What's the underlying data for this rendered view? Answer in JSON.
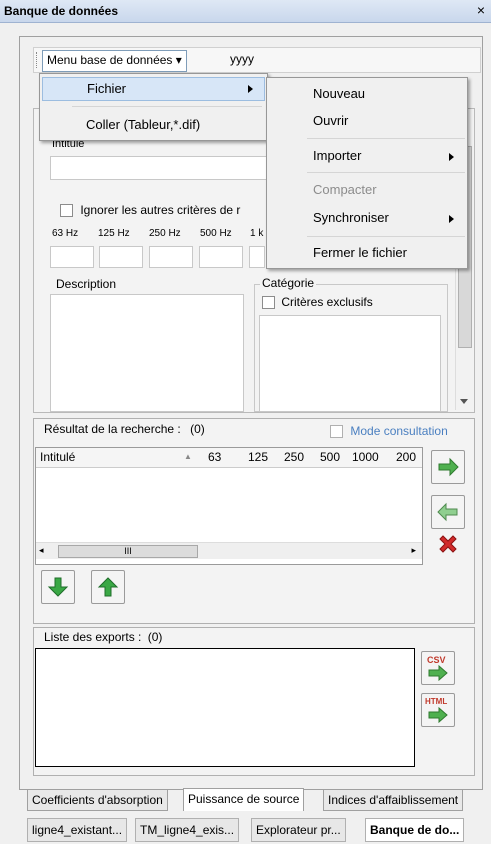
{
  "window": {
    "title": "Banque de données",
    "close_glyph": "×"
  },
  "toolbar": {
    "menu_label": "Menu base de données",
    "menu_arrow": "▾",
    "db_name": "yyyy"
  },
  "form": {
    "intitule_label": "Intitulé",
    "ignore_label": "Ignorer les autres critères de r",
    "freqs": [
      "63 Hz",
      "125 Hz",
      "250 Hz",
      "500 Hz",
      "1 k"
    ],
    "description_label": "Description",
    "categorie_label": "Catégorie",
    "criteres_label": "Critères exclusifs"
  },
  "results": {
    "label": "Résultat de la recherche :",
    "count": "(0)",
    "mode_label": "Mode consultation",
    "columns": [
      "Intitulé",
      "63",
      "125",
      "250",
      "500",
      "1000",
      "200"
    ],
    "scroll_thumb": "III"
  },
  "exports": {
    "label": "Liste des exports :",
    "count": "(0)",
    "csv_label": "CSV",
    "html_label": "HTML"
  },
  "menu1": {
    "items": [
      "Fichier",
      "Coller (Tableur,*.dif)"
    ]
  },
  "submenu": {
    "items": [
      {
        "label": "Nouveau",
        "disabled": false
      },
      {
        "label": "Ouvrir",
        "disabled": false
      },
      {
        "label": "Importer",
        "disabled": false,
        "arrow": true
      },
      {
        "label": "Compacter",
        "disabled": true
      },
      {
        "label": "Synchroniser",
        "disabled": false,
        "arrow": true
      },
      {
        "label": "Fermer le fichier",
        "disabled": false
      }
    ]
  },
  "bottom_tabs": [
    "Coefficients d'absorption",
    "Puissance de source",
    "Indices d'affaiblissement"
  ],
  "doc_tabs": [
    "ligne4_existant...",
    "TM_ligne4_exis...",
    "Explorateur pr...",
    "Banque de do..."
  ],
  "colors": {
    "accent_green": "#3aa845",
    "delete_red": "#d12a2a",
    "menu_highlight": "#d7e6f7"
  }
}
